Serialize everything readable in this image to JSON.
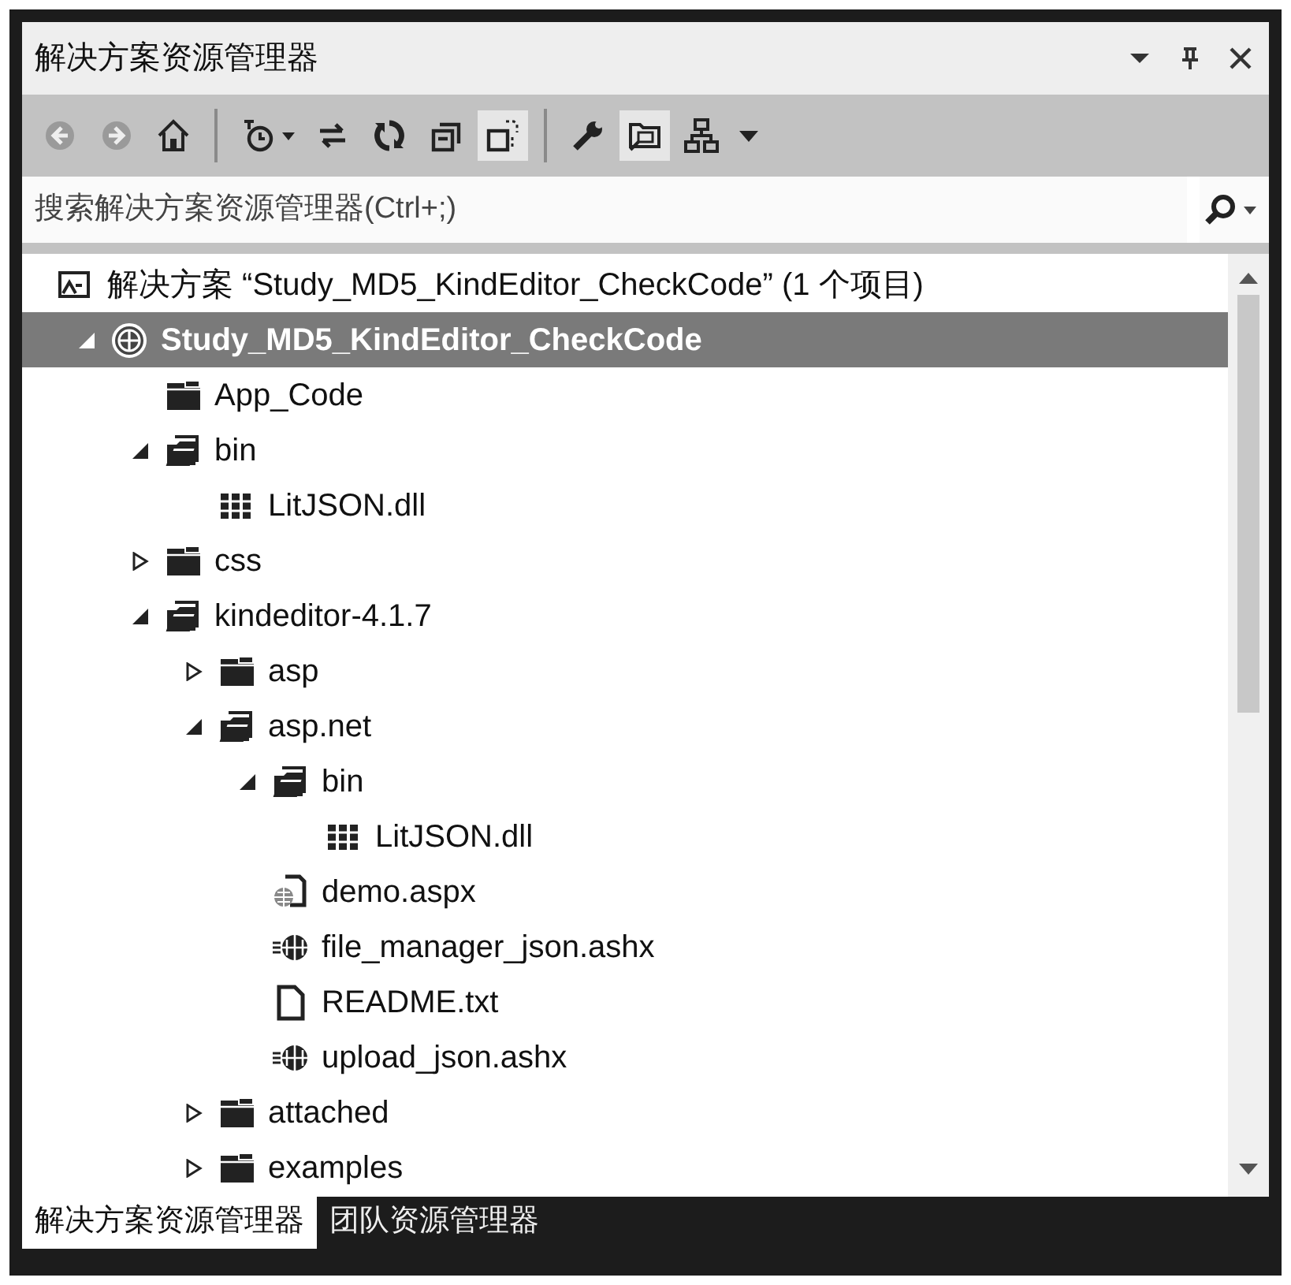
{
  "window": {
    "title": "解决方案资源管理器",
    "buttons": [
      {
        "kind": "menu"
      },
      {
        "kind": "pin"
      },
      {
        "kind": "close"
      }
    ]
  },
  "toolbar": {
    "groups": [
      [
        {
          "kind": "back",
          "disabled": true,
          "active": false
        },
        {
          "kind": "forward",
          "disabled": true,
          "active": false
        },
        {
          "kind": "home",
          "disabled": false,
          "active": false
        }
      ],
      [
        {
          "kind": "history",
          "disabled": false,
          "active": false,
          "dropdown": true
        },
        {
          "kind": "sync",
          "disabled": false,
          "active": false
        },
        {
          "kind": "refresh",
          "disabled": false,
          "active": false
        },
        {
          "kind": "collapse",
          "disabled": false,
          "active": false
        },
        {
          "kind": "show-all",
          "disabled": false,
          "active": true
        }
      ],
      [
        {
          "kind": "properties",
          "disabled": false,
          "active": false
        },
        {
          "kind": "preview",
          "disabled": false,
          "active": true
        },
        {
          "kind": "diagram",
          "disabled": false,
          "active": false
        },
        {
          "kind": "overflow",
          "disabled": false,
          "active": false
        }
      ]
    ]
  },
  "search": {
    "placeholder": "搜索解决方案资源管理器(Ctrl+;)"
  },
  "solution": {
    "label": "解决方案 “Study_MD5_KindEditor_CheckCode” (1 个项目)"
  },
  "tree": [
    {
      "label": "Study_MD5_KindEditor_CheckCode",
      "kind": "project",
      "expanded": true,
      "selected": true,
      "children": [
        {
          "label": "App_Code",
          "kind": "folder",
          "selected": false
        },
        {
          "label": "bin",
          "kind": "folder",
          "expanded": true,
          "selected": false,
          "children": [
            {
              "label": "LitJSON.dll",
              "kind": "dll",
              "selected": false
            }
          ]
        },
        {
          "label": "css",
          "kind": "folder",
          "expanded": false,
          "selected": false
        },
        {
          "label": "kindeditor-4.1.7",
          "kind": "folder",
          "expanded": true,
          "selected": false,
          "children": [
            {
              "label": "asp",
              "kind": "folder",
              "expanded": false,
              "selected": false
            },
            {
              "label": "asp.net",
              "kind": "folder",
              "expanded": true,
              "selected": false,
              "children": [
                {
                  "label": "bin",
                  "kind": "folder",
                  "expanded": true,
                  "selected": false,
                  "children": [
                    {
                      "label": "LitJSON.dll",
                      "kind": "dll",
                      "selected": false
                    }
                  ]
                },
                {
                  "label": "demo.aspx",
                  "kind": "aspx",
                  "selected": false
                },
                {
                  "label": "file_manager_json.ashx",
                  "kind": "ashx",
                  "selected": false
                },
                {
                  "label": "README.txt",
                  "kind": "txt",
                  "selected": false
                },
                {
                  "label": "upload_json.ashx",
                  "kind": "ashx",
                  "selected": false
                }
              ]
            },
            {
              "label": "attached",
              "kind": "folder",
              "expanded": false,
              "selected": false
            },
            {
              "label": "examples",
              "kind": "folder",
              "expanded": false,
              "selected": false
            }
          ]
        }
      ]
    }
  ],
  "bottom_tabs": [
    {
      "label": "解决方案资源管理器",
      "selected": true
    },
    {
      "label": "团队资源管理器",
      "selected": false
    }
  ]
}
